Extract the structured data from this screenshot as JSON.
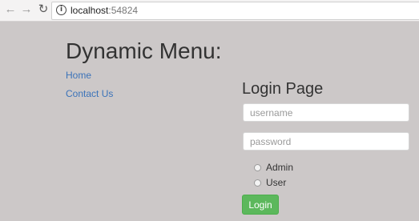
{
  "browser": {
    "host": "localhost",
    "port": ":54824",
    "icons": {
      "back": "arrow-left-icon",
      "forward": "arrow-right-icon",
      "reload": "reload-icon",
      "info": "info-icon"
    }
  },
  "page": {
    "title": "Dynamic Menu:",
    "menu": [
      {
        "label": "Home"
      },
      {
        "label": "Contact Us"
      }
    ],
    "login": {
      "heading": "Login Page",
      "username_placeholder": "username",
      "password_placeholder": "password",
      "roles": [
        {
          "label": "Admin"
        },
        {
          "label": "User"
        }
      ],
      "button_label": "Login"
    }
  },
  "colors": {
    "background": "#ccc8c8",
    "link": "#3b73b9",
    "button": "#5cb85c"
  }
}
